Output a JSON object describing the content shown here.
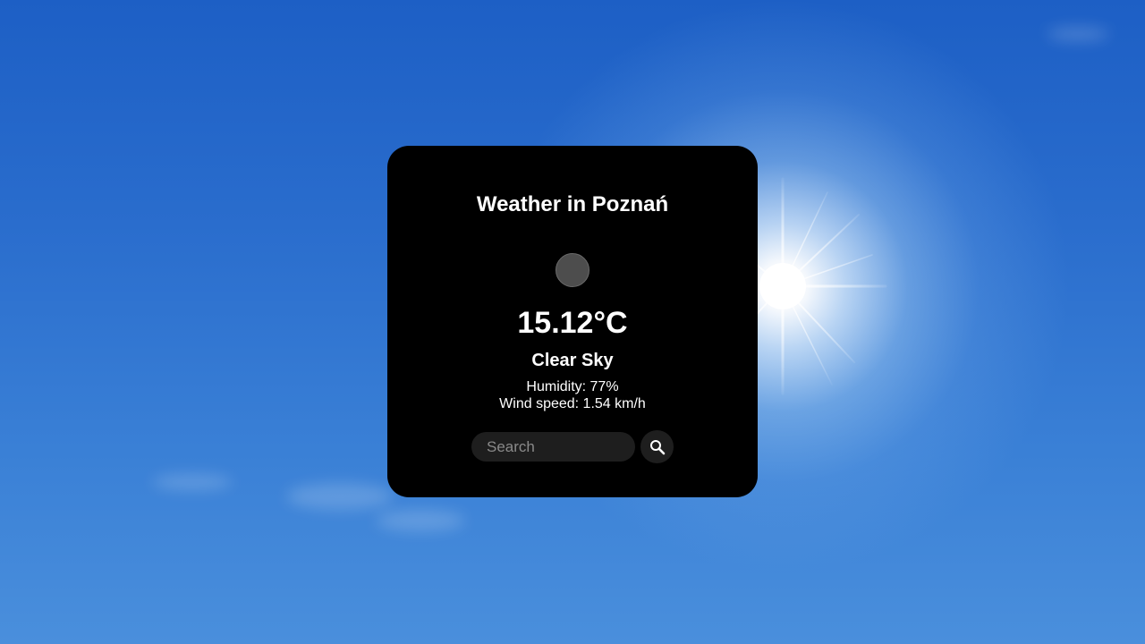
{
  "card": {
    "title": "Weather in Poznań",
    "temperature": "15.12°C",
    "description": "Clear Sky",
    "humidity": "Humidity: 77%",
    "wind_speed": "Wind speed: 1.54 km/h",
    "weather_icon": "weather-icon-placeholder"
  },
  "search": {
    "placeholder": "Search",
    "value": "",
    "button_icon": "search-icon"
  },
  "colors": {
    "card_background": "#000000",
    "text": "#ffffff",
    "input_background": "#1e1e1e",
    "sky": "#2a6dcd"
  }
}
